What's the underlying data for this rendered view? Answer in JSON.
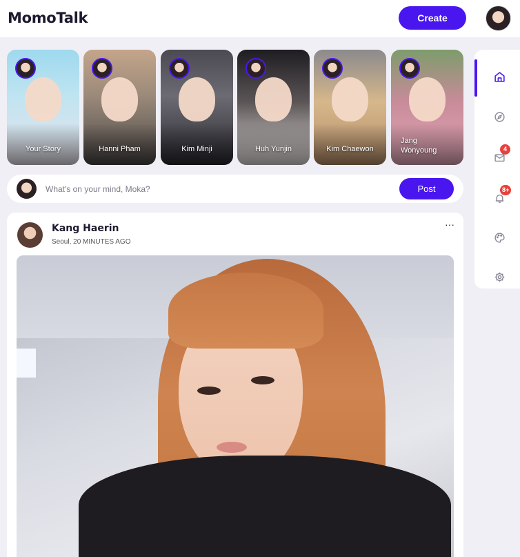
{
  "app": {
    "brand": "MomoTalk",
    "create_label": "Create",
    "accent_color": "#4a16f0"
  },
  "stories": [
    {
      "name": "Your Story",
      "bg": "linear-gradient(180deg,#9ed9ee 0%,#bfe4f1 40%,#e8e3ea 100%)"
    },
    {
      "name": "Hanni Pham",
      "bg": "linear-gradient(180deg,#c4a58a 0%,#9b8a7a 40%,#4a4646 100%)"
    },
    {
      "name": "Kim Minji",
      "bg": "linear-gradient(180deg,#4b4a52 0%,#6c6a72 40%,#2a2930 100%)"
    },
    {
      "name": "Huh Yunjin",
      "bg": "linear-gradient(180deg,#1f1d22 0%,#5a5455 45%,#e7e3e0 100%)"
    },
    {
      "name": "Kim Chaewon",
      "bg": "linear-gradient(180deg,#8b8a8c 0%,#d6b78b 45%,#b58e6a 100%)"
    },
    {
      "name": "Jang Wonyoung",
      "bg": "linear-gradient(180deg,#7d9c6b 0%,#c88b99 45%,#e3a7b8 100%)"
    }
  ],
  "composer": {
    "placeholder": "What's on your mind, Moka?",
    "post_label": "Post"
  },
  "nav": [
    {
      "icon": "home-icon",
      "active": true
    },
    {
      "icon": "compass-icon",
      "active": false
    },
    {
      "icon": "mail-icon",
      "active": false,
      "badge": "4"
    },
    {
      "icon": "bell-icon",
      "active": false,
      "badge": "8+"
    },
    {
      "icon": "palette-icon",
      "active": false
    },
    {
      "icon": "settings-icon",
      "active": false
    }
  ],
  "post": {
    "author": "Kang Haerin",
    "meta": "Seoul, 20 MINUTES AGO",
    "more": "···"
  }
}
